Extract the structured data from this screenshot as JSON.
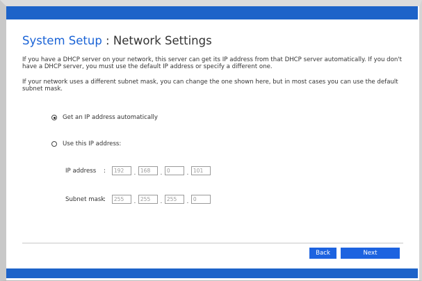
{
  "header": {
    "title_section": "System Setup",
    "title_separator": " : ",
    "title_page": "Network Settings"
  },
  "intro": {
    "paragraph1": "If you have a DHCP server on your network, this server can get its IP address from that DHCP server automatically. If you don't have a DHCP server, you must use the default IP address or specify a different one.",
    "paragraph2": "If your network uses a different subnet mask, you can change the one shown here, but in most cases you can use the default subnet mask."
  },
  "options": {
    "auto_label": "Get an IP address automatically",
    "auto_selected": true,
    "manual_label": "Use this IP address:",
    "manual_selected": false
  },
  "ip_address": {
    "label": "IP address",
    "colon": ":",
    "octets": [
      "192",
      "168",
      "0",
      "101"
    ],
    "disabled": true
  },
  "subnet_mask": {
    "label": "Subnet mask",
    "colon": ":",
    "octets": [
      "255",
      "255",
      "255",
      "0"
    ],
    "disabled": true
  },
  "separator": ".",
  "footer": {
    "back_label": "Back",
    "next_label": "Next"
  },
  "colors": {
    "accent": "#1d63c9",
    "title_blue": "#1a63d6",
    "button": "#1d63e0"
  }
}
